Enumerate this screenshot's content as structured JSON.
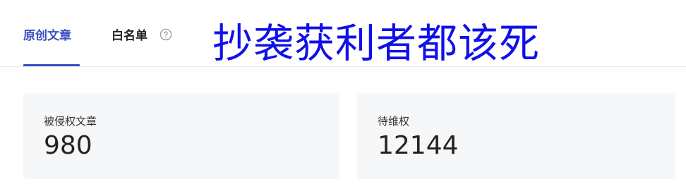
{
  "tabs": {
    "original_label": "原创文章",
    "whitelist_label": "白名单"
  },
  "overlay": {
    "text": "抄袭获利者都该死",
    "color": "#1010e8"
  },
  "stats": {
    "infringed": {
      "label": "被侵权文章",
      "value": "980"
    },
    "pending": {
      "label": "待维权",
      "value": "12144"
    }
  },
  "icons": {
    "help": "help-circle-icon"
  },
  "colors": {
    "accent": "#3b4fc4",
    "card_background": "#f6f7f9"
  }
}
